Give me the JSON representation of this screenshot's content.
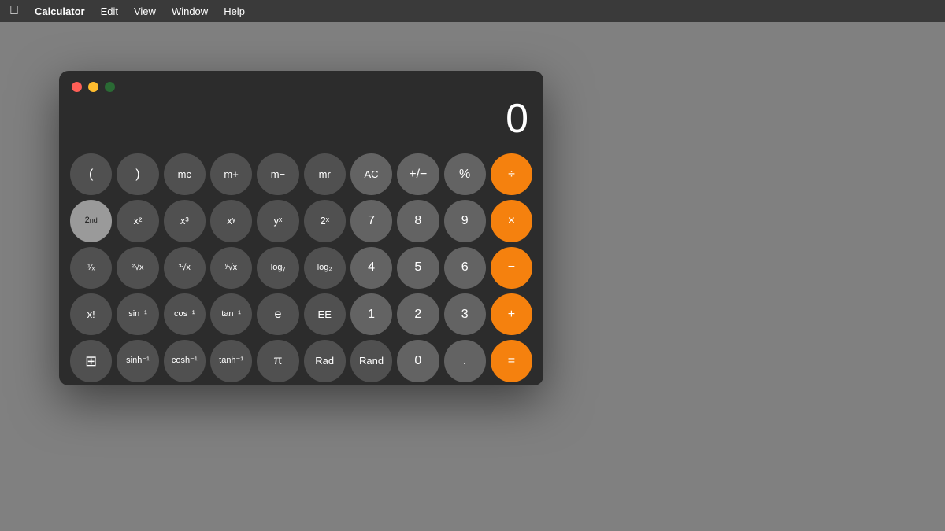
{
  "menubar": {
    "apple": "🍎",
    "items": [
      "Calculator",
      "Edit",
      "View",
      "Window",
      "Help"
    ]
  },
  "window": {
    "title": "Calculator",
    "display": "0"
  },
  "buttons": {
    "row1": [
      {
        "label": "(",
        "type": "dark"
      },
      {
        "label": ")",
        "type": "dark"
      },
      {
        "label": "mc",
        "type": "dark"
      },
      {
        "label": "m+",
        "type": "dark"
      },
      {
        "label": "m−",
        "type": "dark"
      },
      {
        "label": "mr",
        "type": "dark"
      },
      {
        "label": "AC",
        "type": "medium"
      },
      {
        "label": "+/−",
        "type": "medium"
      },
      {
        "label": "%",
        "type": "medium"
      },
      {
        "label": "÷",
        "type": "orange"
      }
    ],
    "row2": [
      {
        "label": "2nd",
        "type": "2nd"
      },
      {
        "label": "x²",
        "type": "dark"
      },
      {
        "label": "x³",
        "type": "dark"
      },
      {
        "label": "xʸ",
        "type": "dark"
      },
      {
        "label": "yˣ",
        "type": "dark"
      },
      {
        "label": "2ˣ",
        "type": "dark"
      },
      {
        "label": "7",
        "type": "medium"
      },
      {
        "label": "8",
        "type": "medium"
      },
      {
        "label": "9",
        "type": "medium"
      },
      {
        "label": "×",
        "type": "orange"
      }
    ],
    "row3": [
      {
        "label": "¹∕ₓ",
        "type": "dark"
      },
      {
        "label": "²√x",
        "type": "dark"
      },
      {
        "label": "³√x",
        "type": "dark"
      },
      {
        "label": "ʸ√x",
        "type": "dark"
      },
      {
        "label": "logᵧ",
        "type": "dark"
      },
      {
        "label": "log₂",
        "type": "dark"
      },
      {
        "label": "4",
        "type": "medium"
      },
      {
        "label": "5",
        "type": "medium"
      },
      {
        "label": "6",
        "type": "medium"
      },
      {
        "label": "−",
        "type": "orange"
      }
    ],
    "row4": [
      {
        "label": "x!",
        "type": "dark"
      },
      {
        "label": "sin⁻¹",
        "type": "dark"
      },
      {
        "label": "cos⁻¹",
        "type": "dark"
      },
      {
        "label": "tan⁻¹",
        "type": "dark"
      },
      {
        "label": "e",
        "type": "dark"
      },
      {
        "label": "EE",
        "type": "dark"
      },
      {
        "label": "1",
        "type": "medium"
      },
      {
        "label": "2",
        "type": "medium"
      },
      {
        "label": "3",
        "type": "medium"
      },
      {
        "label": "+",
        "type": "orange"
      }
    ],
    "row5": [
      {
        "label": "⊞",
        "type": "dark"
      },
      {
        "label": "sinh⁻¹",
        "type": "dark"
      },
      {
        "label": "cosh⁻¹",
        "type": "dark"
      },
      {
        "label": "tanh⁻¹",
        "type": "dark"
      },
      {
        "label": "π",
        "type": "dark"
      },
      {
        "label": "Rad",
        "type": "dark"
      },
      {
        "label": "Rand",
        "type": "dark"
      },
      {
        "label": "0",
        "type": "medium"
      },
      {
        "label": ".",
        "type": "medium"
      },
      {
        "label": "=",
        "type": "orange"
      }
    ]
  }
}
